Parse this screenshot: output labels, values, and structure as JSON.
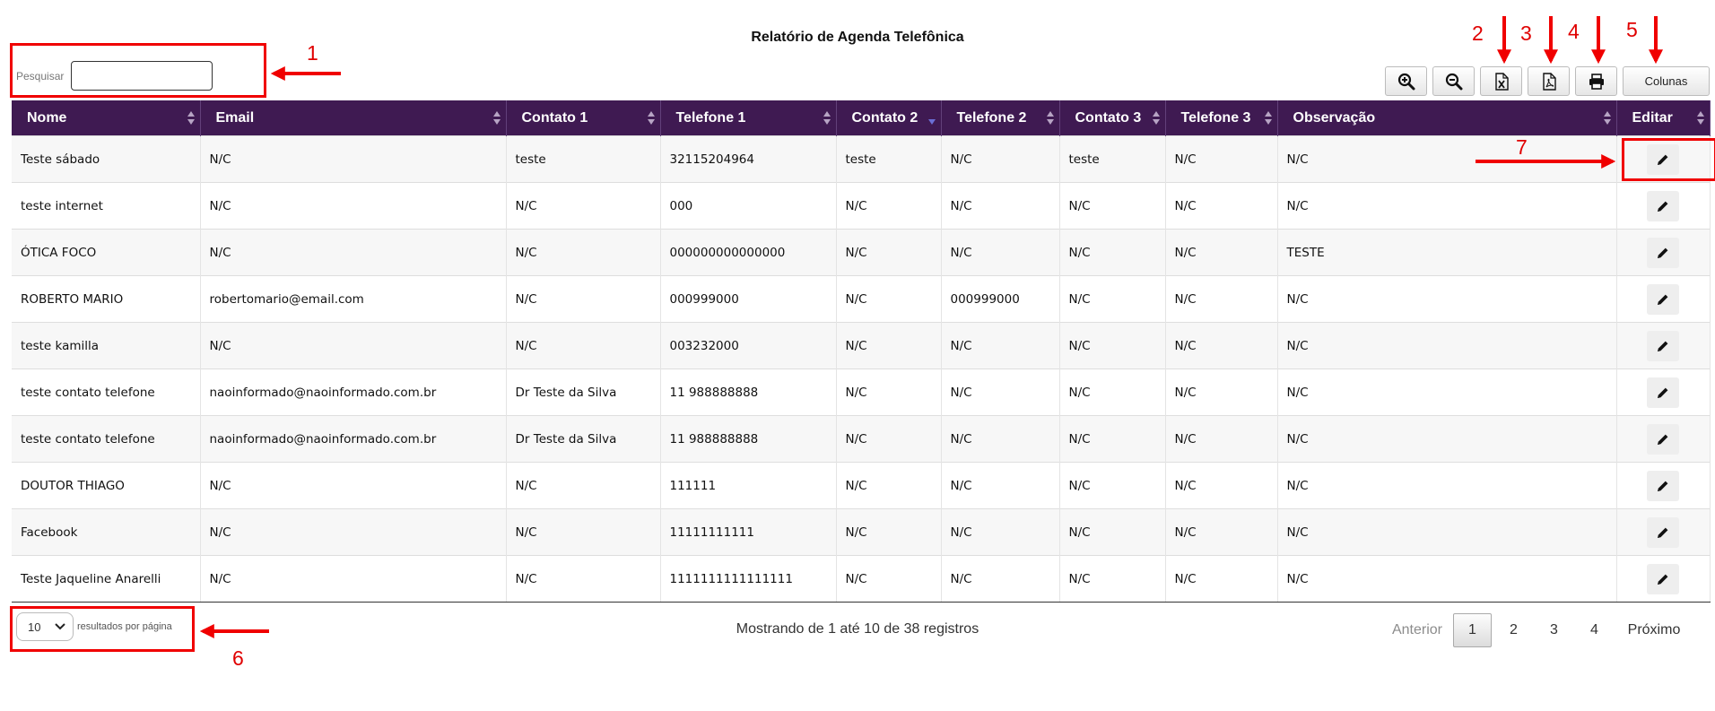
{
  "report": {
    "title": "Relatório de Agenda Telefônica"
  },
  "search": {
    "label": "Pesquisar",
    "value": ""
  },
  "toolbar": {
    "zoom_in_icon": "zoom-in-icon",
    "zoom_out_icon": "zoom-out-icon",
    "excel_icon": "excel-icon",
    "pdf_icon": "pdf-icon",
    "print_icon": "print-icon",
    "columns_label": "Colunas"
  },
  "table": {
    "columns": [
      {
        "label": "Nome",
        "sort": "none"
      },
      {
        "label": "Email",
        "sort": "none"
      },
      {
        "label": "Contato 1",
        "sort": "none"
      },
      {
        "label": "Telefone 1",
        "sort": "none"
      },
      {
        "label": "Contato 2",
        "sort": "desc"
      },
      {
        "label": "Telefone 2",
        "sort": "none"
      },
      {
        "label": "Contato 3",
        "sort": "none"
      },
      {
        "label": "Telefone 3",
        "sort": "none"
      },
      {
        "label": "Observação",
        "sort": "none"
      },
      {
        "label": "Editar",
        "sort": "none"
      }
    ],
    "rows": [
      [
        "Teste sábado",
        "N/C",
        "teste",
        "32115204964",
        "teste",
        "N/C",
        "teste",
        "N/C",
        "N/C"
      ],
      [
        "teste internet",
        "N/C",
        "N/C",
        "000",
        "N/C",
        "N/C",
        "N/C",
        "N/C",
        "N/C"
      ],
      [
        "ÓTICA FOCO",
        "N/C",
        "N/C",
        "000000000000000",
        "N/C",
        "N/C",
        "N/C",
        "N/C",
        "TESTE"
      ],
      [
        "ROBERTO MARIO",
        "robertomario@email.com",
        "N/C",
        "000999000",
        "N/C",
        "000999000",
        "N/C",
        "N/C",
        "N/C"
      ],
      [
        "teste kamilla",
        "N/C",
        "N/C",
        "003232000",
        "N/C",
        "N/C",
        "N/C",
        "N/C",
        "N/C"
      ],
      [
        "teste contato telefone",
        "naoinformado@naoinformado.com.br",
        "Dr Teste da Silva",
        "11 988888888",
        "N/C",
        "N/C",
        "N/C",
        "N/C",
        "N/C"
      ],
      [
        "teste contato telefone",
        "naoinformado@naoinformado.com.br",
        "Dr Teste da Silva",
        "11 988888888",
        "N/C",
        "N/C",
        "N/C",
        "N/C",
        "N/C"
      ],
      [
        "DOUTOR THIAGO",
        "N/C",
        "N/C",
        "111111",
        "N/C",
        "N/C",
        "N/C",
        "N/C",
        "N/C"
      ],
      [
        "Facebook",
        "N/C",
        "N/C",
        "11111111111",
        "N/C",
        "N/C",
        "N/C",
        "N/C",
        "N/C"
      ],
      [
        "Teste Jaqueline Anarelli",
        "N/C",
        "N/C",
        "1111111111111111",
        "N/C",
        "N/C",
        "N/C",
        "N/C",
        "N/C"
      ]
    ],
    "edit_icon": "pencil-icon"
  },
  "footer": {
    "page_size_value": "10",
    "page_size_label": "resultados por página",
    "info": "Mostrando de 1 até 10 de 38 registros",
    "prev_label": "Anterior",
    "pages": [
      "1",
      "2",
      "3",
      "4"
    ],
    "current_page": "1",
    "next_label": "Próximo"
  },
  "annotations": {
    "color": "#f00000",
    "labels": [
      "1",
      "2",
      "3",
      "4",
      "5",
      "6",
      "7"
    ]
  }
}
